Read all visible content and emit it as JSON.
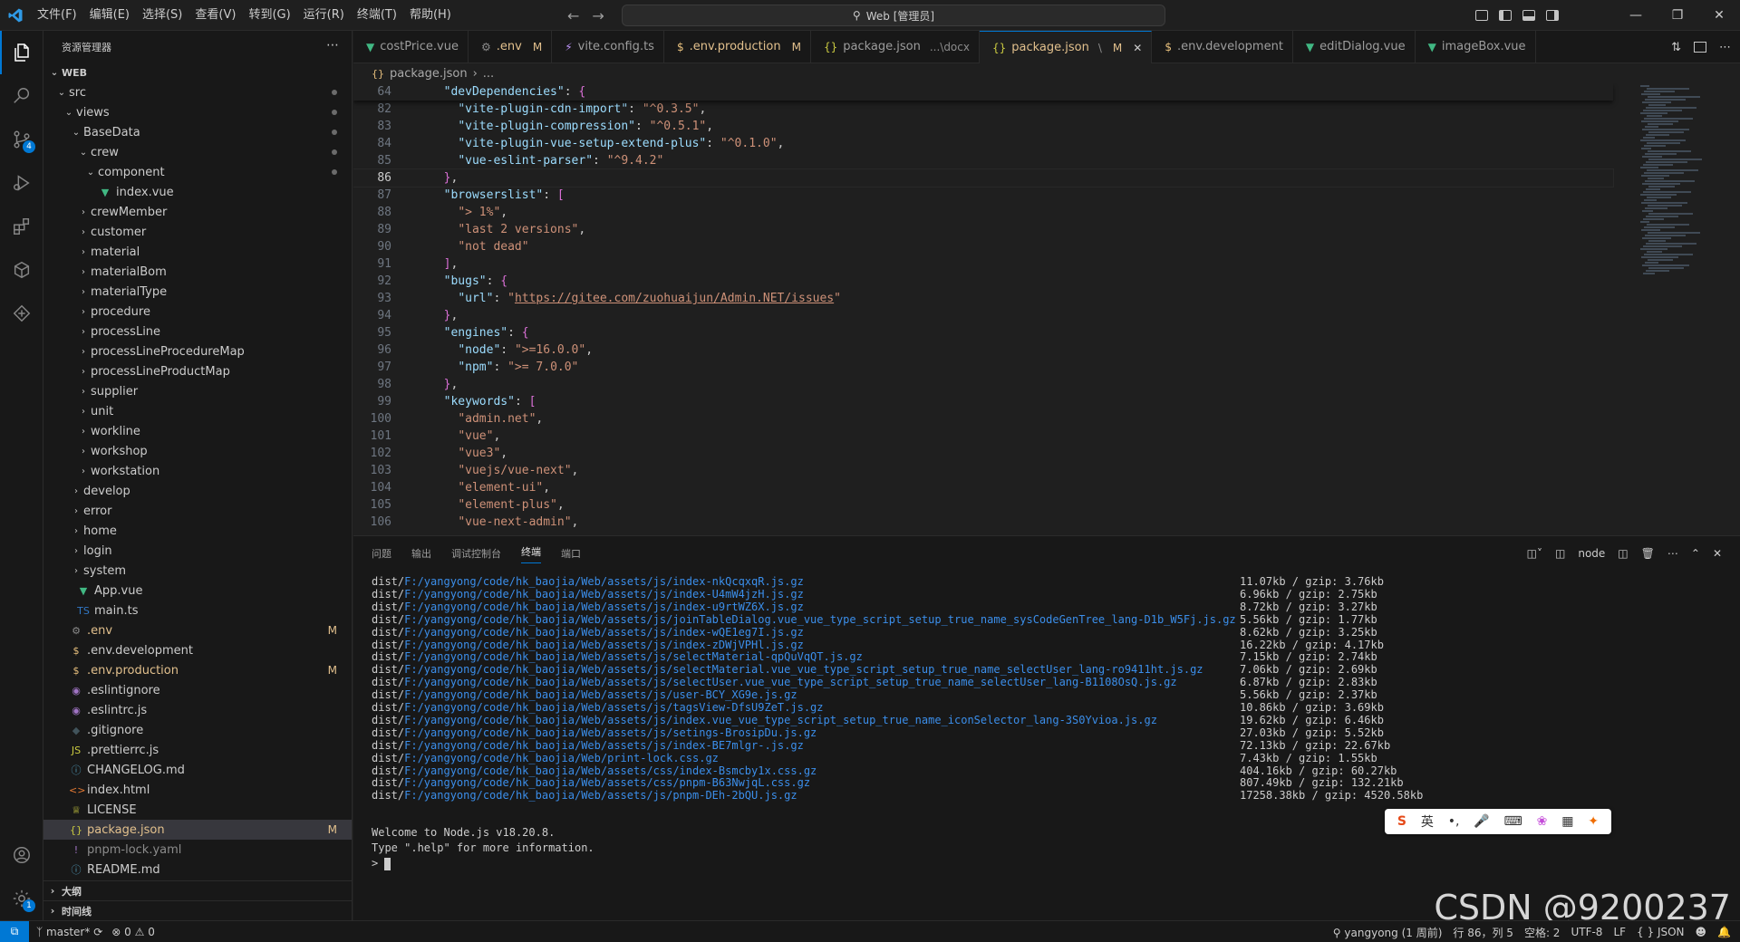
{
  "colors": {
    "accent": "#0078d4",
    "modified": "#e2c08d",
    "path": "#3b8eea"
  },
  "titlebar": {
    "menu": [
      "文件(F)",
      "编辑(E)",
      "选择(S)",
      "查看(V)",
      "转到(G)",
      "运行(R)",
      "终端(T)",
      "帮助(H)"
    ],
    "command_center": "Web [管理员]"
  },
  "activitybar": {
    "scm_badge": "4",
    "accounts_badge": "1"
  },
  "sidebar": {
    "title": "资源管理器",
    "root": "WEB",
    "items": [
      {
        "label": "src",
        "depth": 1,
        "type": "folder-open",
        "dot": true
      },
      {
        "label": "views",
        "depth": 2,
        "type": "folder-open",
        "dot": true
      },
      {
        "label": "BaseData",
        "depth": 3,
        "type": "folder-open",
        "dot": true
      },
      {
        "label": "crew",
        "depth": 4,
        "type": "folder-open",
        "dot": true
      },
      {
        "label": "component",
        "depth": 5,
        "type": "folder-open",
        "dot": true
      },
      {
        "label": "index.vue",
        "depth": 5,
        "type": "vue"
      },
      {
        "label": "crewMember",
        "depth": 4,
        "type": "folder"
      },
      {
        "label": "customer",
        "depth": 4,
        "type": "folder"
      },
      {
        "label": "material",
        "depth": 4,
        "type": "folder"
      },
      {
        "label": "materialBom",
        "depth": 4,
        "type": "folder"
      },
      {
        "label": "materialType",
        "depth": 4,
        "type": "folder"
      },
      {
        "label": "procedure",
        "depth": 4,
        "type": "folder"
      },
      {
        "label": "processLine",
        "depth": 4,
        "type": "folder"
      },
      {
        "label": "processLineProcedureMap",
        "depth": 4,
        "type": "folder"
      },
      {
        "label": "processLineProductMap",
        "depth": 4,
        "type": "folder"
      },
      {
        "label": "supplier",
        "depth": 4,
        "type": "folder"
      },
      {
        "label": "unit",
        "depth": 4,
        "type": "folder"
      },
      {
        "label": "workline",
        "depth": 4,
        "type": "folder"
      },
      {
        "label": "workshop",
        "depth": 4,
        "type": "folder"
      },
      {
        "label": "workstation",
        "depth": 4,
        "type": "folder"
      },
      {
        "label": "develop",
        "depth": 3,
        "type": "folder"
      },
      {
        "label": "error",
        "depth": 3,
        "type": "folder"
      },
      {
        "label": "home",
        "depth": 3,
        "type": "folder"
      },
      {
        "label": "login",
        "depth": 3,
        "type": "folder"
      },
      {
        "label": "system",
        "depth": 3,
        "type": "folder"
      },
      {
        "label": "App.vue",
        "depth": 2,
        "type": "vue"
      },
      {
        "label": "main.ts",
        "depth": 2,
        "type": "ts"
      },
      {
        "label": ".env",
        "depth": 1,
        "type": "gear",
        "badge": "M"
      },
      {
        "label": ".env.development",
        "depth": 1,
        "type": "dollar"
      },
      {
        "label": ".env.production",
        "depth": 1,
        "type": "dollar",
        "badge": "M"
      },
      {
        "label": ".eslintignore",
        "depth": 1,
        "type": "eslint"
      },
      {
        "label": ".eslintrc.js",
        "depth": 1,
        "type": "eslint"
      },
      {
        "label": ".gitignore",
        "depth": 1,
        "type": "git"
      },
      {
        "label": ".prettierrc.js",
        "depth": 1,
        "type": "js"
      },
      {
        "label": "CHANGELOG.md",
        "depth": 1,
        "type": "info"
      },
      {
        "label": "index.html",
        "depth": 1,
        "type": "html"
      },
      {
        "label": "LICENSE",
        "depth": 1,
        "type": "license"
      },
      {
        "label": "package.json",
        "depth": 1,
        "type": "json",
        "badge": "M",
        "selected": true
      },
      {
        "label": "pnpm-lock.yaml",
        "depth": 1,
        "type": "yaml",
        "dim": true
      },
      {
        "label": "README.md",
        "depth": 1,
        "type": "info"
      }
    ],
    "sections": [
      "大纲",
      "时间线"
    ]
  },
  "tabs": [
    {
      "label": "costPrice.vue",
      "icon": "vue"
    },
    {
      "label": ".env",
      "icon": "gear",
      "mod": "M"
    },
    {
      "label": "vite.config.ts",
      "icon": "vite"
    },
    {
      "label": ".env.production",
      "icon": "dollar",
      "mod": "M"
    },
    {
      "label": "package.json",
      "icon": "json",
      "desc": "...\\docx"
    },
    {
      "label": "package.json",
      "icon": "json",
      "desc": "\\",
      "mod": "M",
      "active": true
    },
    {
      "label": ".env.development",
      "icon": "dollar"
    },
    {
      "label": "editDialog.vue",
      "icon": "vue"
    },
    {
      "label": "imageBox.vue",
      "icon": "vue"
    }
  ],
  "breadcrumb": {
    "file": "package.json",
    "rest": "..."
  },
  "editor": {
    "sticky": {
      "ln": "64",
      "text": "  \"devDependencies\": {"
    },
    "current_line": "86",
    "lines": [
      {
        "ln": "82",
        "t": "    \"vite-plugin-cdn-import\": \"^0.3.5\","
      },
      {
        "ln": "83",
        "t": "    \"vite-plugin-compression\": \"^0.5.1\","
      },
      {
        "ln": "84",
        "t": "    \"vite-plugin-vue-setup-extend-plus\": \"^0.1.0\","
      },
      {
        "ln": "85",
        "t": "    \"vue-eslint-parser\": \"^9.4.2\""
      },
      {
        "ln": "86",
        "t": "  },"
      },
      {
        "ln": "87",
        "t": "  \"browserslist\": ["
      },
      {
        "ln": "88",
        "t": "    \"> 1%\","
      },
      {
        "ln": "89",
        "t": "    \"last 2 versions\","
      },
      {
        "ln": "90",
        "t": "    \"not dead\""
      },
      {
        "ln": "91",
        "t": "  ],"
      },
      {
        "ln": "92",
        "t": "  \"bugs\": {"
      },
      {
        "ln": "93",
        "t": "    \"url\": \"https://gitee.com/zuohuaijun/Admin.NET/issues\""
      },
      {
        "ln": "94",
        "t": "  },"
      },
      {
        "ln": "95",
        "t": "  \"engines\": {"
      },
      {
        "ln": "96",
        "t": "    \"node\": \">=16.0.0\","
      },
      {
        "ln": "97",
        "t": "    \"npm\": \">= 7.0.0\""
      },
      {
        "ln": "98",
        "t": "  },"
      },
      {
        "ln": "99",
        "t": "  \"keywords\": ["
      },
      {
        "ln": "100",
        "t": "    \"admin.net\","
      },
      {
        "ln": "101",
        "t": "    \"vue\","
      },
      {
        "ln": "102",
        "t": "    \"vue3\","
      },
      {
        "ln": "103",
        "t": "    \"vuejs/vue-next\","
      },
      {
        "ln": "104",
        "t": "    \"element-ui\","
      },
      {
        "ln": "105",
        "t": "    \"element-plus\","
      },
      {
        "ln": "106",
        "t": "    \"vue-next-admin\","
      }
    ]
  },
  "panel": {
    "tabs": [
      "问题",
      "输出",
      "调试控制台",
      "终端",
      "端口"
    ],
    "active_tab": "终端",
    "shell": "node",
    "output": [
      {
        "prefix": "dist/",
        "path": "F:/yangyong/code/hk_baojia/Web/assets/js/index-nkQcqxqR.js.gz",
        "size": "11.07kb / gzip: 3.76kb"
      },
      {
        "prefix": "dist/",
        "path": "F:/yangyong/code/hk_baojia/Web/assets/js/index-U4mW4jzH.js.gz",
        "size": "6.96kb / gzip: 2.75kb"
      },
      {
        "prefix": "dist/",
        "path": "F:/yangyong/code/hk_baojia/Web/assets/js/index-u9rtWZ6X.js.gz",
        "size": "8.72kb / gzip: 3.27kb"
      },
      {
        "prefix": "dist/",
        "path": "F:/yangyong/code/hk_baojia/Web/assets/js/joinTableDialog.vue_vue_type_script_setup_true_name_sysCodeGenTree_lang-D1b_W5Fj.js.gz",
        "size": "5.56kb / gzip: 1.77kb"
      },
      {
        "prefix": "dist/",
        "path": "F:/yangyong/code/hk_baojia/Web/assets/js/index-wQE1eg7I.js.gz",
        "size": "8.62kb / gzip: 3.25kb"
      },
      {
        "prefix": "dist/",
        "path": "F:/yangyong/code/hk_baojia/Web/assets/js/index-zDWjVPHl.js.gz",
        "size": "16.22kb / gzip: 4.17kb"
      },
      {
        "prefix": "dist/",
        "path": "F:/yangyong/code/hk_baojia/Web/assets/js/selectMaterial-qpQuVqQT.js.gz",
        "size": "7.15kb / gzip: 2.74kb"
      },
      {
        "prefix": "dist/",
        "path": "F:/yangyong/code/hk_baojia/Web/assets/js/selectMaterial.vue_vue_type_script_setup_true_name_selectUser_lang-ro9411ht.js.gz",
        "size": "7.06kb / gzip: 2.69kb"
      },
      {
        "prefix": "dist/",
        "path": "F:/yangyong/code/hk_baojia/Web/assets/js/selectUser.vue_vue_type_script_setup_true_name_selectUser_lang-B1108OsQ.js.gz",
        "size": "6.87kb / gzip: 2.83kb"
      },
      {
        "prefix": "dist/",
        "path": "F:/yangyong/code/hk_baojia/Web/assets/js/user-BCY_XG9e.js.gz",
        "size": "5.56kb / gzip: 2.37kb"
      },
      {
        "prefix": "dist/",
        "path": "F:/yangyong/code/hk_baojia/Web/assets/js/tagsView-DfsU9ZeT.js.gz",
        "size": "10.86kb / gzip: 3.69kb"
      },
      {
        "prefix": "dist/",
        "path": "F:/yangyong/code/hk_baojia/Web/assets/js/index.vue_vue_type_script_setup_true_name_iconSelector_lang-3S0Yvioa.js.gz",
        "size": "19.62kb / gzip: 6.46kb"
      },
      {
        "prefix": "dist/",
        "path": "F:/yangyong/code/hk_baojia/Web/assets/js/setings-BrosipDu.js.gz",
        "size": "27.03kb / gzip: 5.52kb"
      },
      {
        "prefix": "dist/",
        "path": "F:/yangyong/code/hk_baojia/Web/assets/js/index-BE7mlgr-.js.gz",
        "size": "72.13kb / gzip: 22.67kb"
      },
      {
        "prefix": "dist/",
        "path": "F:/yangyong/code/hk_baojia/Web/print-lock.css.gz",
        "size": "7.43kb / gzip: 1.55kb"
      },
      {
        "prefix": "dist/",
        "path": "F:/yangyong/code/hk_baojia/Web/assets/css/index-Bsmcby1x.css.gz",
        "size": "404.16kb / gzip: 60.27kb"
      },
      {
        "prefix": "dist/",
        "path": "F:/yangyong/code/hk_baojia/Web/assets/css/pnpm-B63NwjqL.css.gz",
        "size": "807.49kb / gzip: 132.21kb"
      },
      {
        "prefix": "dist/",
        "path": "F:/yangyong/code/hk_baojia/Web/assets/js/pnpm-DEh-2bQU.js.gz",
        "size": "17258.38kb / gzip: 4520.58kb"
      }
    ],
    "welcome": "Welcome to Node.js v18.20.8.",
    "help": "Type \".help\" for more information.",
    "prompt": ">"
  },
  "ime": {
    "mode": "英"
  },
  "watermark": "CSDN @9200237",
  "statusbar": {
    "branch": "master*",
    "errors": "0",
    "warnings": "0",
    "blame": "yangyong (1 周前)",
    "position": "行 86，列 5",
    "spaces": "空格: 2",
    "encoding": "UTF-8",
    "eol": "LF",
    "language": "JSON"
  }
}
